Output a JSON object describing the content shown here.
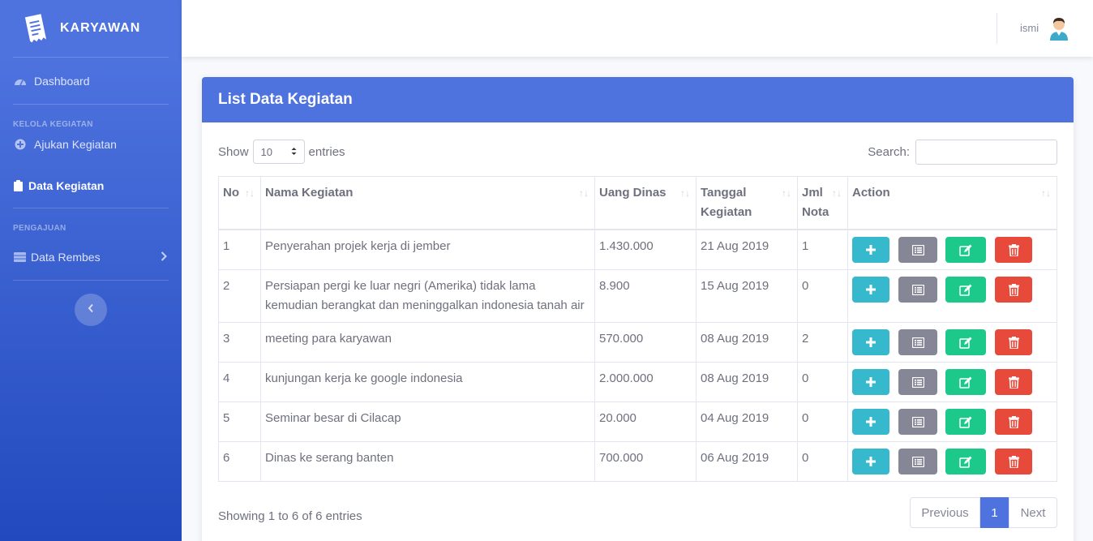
{
  "brand": {
    "name": "KARYAWAN",
    "logo_icon": "receipt-icon"
  },
  "sidebar": {
    "dashboard": "Dashboard",
    "heading_kelola": "KELOLA KEGIATAN",
    "ajukan": "Ajukan Kegiatan",
    "data_kegiatan": "Data Kegiatan",
    "heading_pengajuan": "PENGAJUAN",
    "data_rembes": "Data Rembes"
  },
  "topbar": {
    "username": "ismi"
  },
  "card": {
    "title": "List Data Kegiatan"
  },
  "controls": {
    "show_label": "Show",
    "entries_value": "10",
    "entries_label": "entries",
    "search_label": "Search:",
    "search_value": ""
  },
  "table": {
    "headers": [
      "No",
      "Nama Kegiatan",
      "Uang Dinas",
      "Tanggal Kegiatan",
      "Jml Nota",
      "Action"
    ],
    "rows": [
      {
        "no": "1",
        "nama": "Penyerahan projek kerja di jember",
        "uang": "1.430.000",
        "tanggal": "21 Aug 2019",
        "nota": "1"
      },
      {
        "no": "2",
        "nama": "Persiapan pergi ke luar negri (Amerika) tidak lama kemudian berangkat dan meninggalkan indonesia tanah air",
        "uang": "8.900",
        "tanggal": "15 Aug 2019",
        "nota": "0"
      },
      {
        "no": "3",
        "nama": "meeting para karyawan",
        "uang": "570.000",
        "tanggal": "08 Aug 2019",
        "nota": "2"
      },
      {
        "no": "4",
        "nama": "kunjungan kerja ke google indonesia",
        "uang": "2.000.000",
        "tanggal": "08 Aug 2019",
        "nota": "0"
      },
      {
        "no": "5",
        "nama": "Seminar besar di Cilacap",
        "uang": "20.000",
        "tanggal": "04 Aug 2019",
        "nota": "0"
      },
      {
        "no": "6",
        "nama": "Dinas ke serang banten",
        "uang": "700.000",
        "tanggal": "06 Aug 2019",
        "nota": "0"
      }
    ]
  },
  "footer": {
    "info": "Showing 1 to 6 of 6 entries",
    "prev": "Previous",
    "page": "1",
    "next": "Next"
  },
  "colors": {
    "primary": "#4e73df",
    "info": "#36b9cc",
    "secondary": "#858796",
    "success": "#1cc88a",
    "danger": "#e74a3b"
  }
}
